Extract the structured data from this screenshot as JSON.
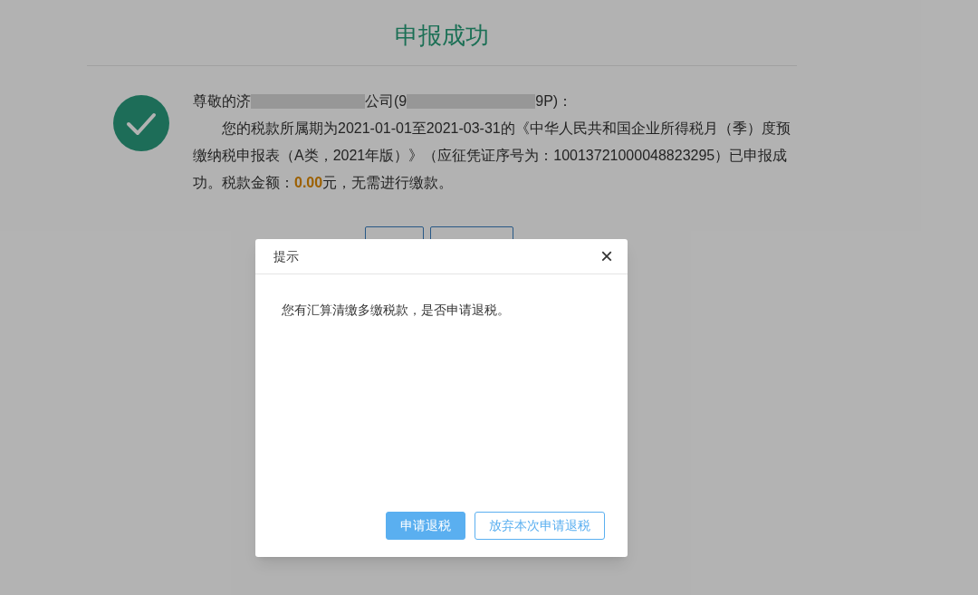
{
  "page": {
    "title": "申报成功",
    "greeting": {
      "prefix": "尊敬的济",
      "middle": "公司(9",
      "suffix": "9P)："
    },
    "message": "您的税款所属期为2021-01-01至2021-03-31的《中华人民共和国企业所得税月（季）度预缴纳税申报表（A类，2021年版）》（应征凭证序号为：10013721000048823295）已申报成功。税款金额：**0.00**元，无需进行缴款。",
    "buttons": [
      {
        "kind": "narrow"
      },
      {
        "kind": "wide"
      }
    ]
  },
  "dialog": {
    "title": "提示",
    "close": "×",
    "message": "您有汇算清缴多缴税款，是否申请退税。",
    "buttons": [
      {
        "label": "申请退税",
        "kind": "primary"
      },
      {
        "label": "放弃本次申请退税",
        "kind": "outline"
      }
    ]
  }
}
